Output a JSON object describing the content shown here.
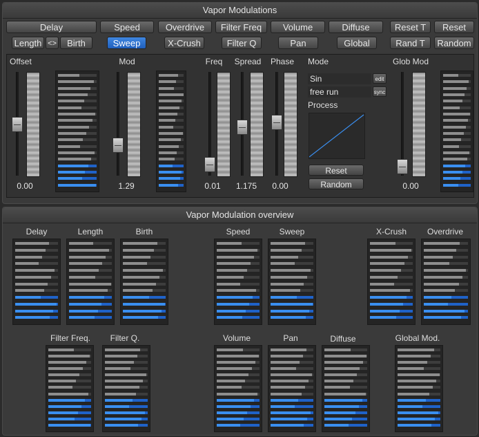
{
  "top_panel": {
    "title": "Vapor Modulations",
    "row1": [
      "Delay",
      "Speed",
      "Overdrive",
      "Filter Freq",
      "Volume",
      "Diffuse",
      "Reset T",
      "Reset"
    ],
    "row2": [
      "Length",
      "<>",
      "Birth",
      "Sweep",
      "X-Crush",
      "Filter Q",
      "Pan",
      "Global",
      "Rand T",
      "Random"
    ],
    "active_tab": "Sweep",
    "labels": {
      "offset": "Offset",
      "mod": "Mod",
      "freq": "Freq",
      "spread": "Spread",
      "phase": "Phase",
      "mode": "Mode",
      "glob_mod": "Glob Mod"
    },
    "values": {
      "offset": "0.00",
      "mod": "1.29",
      "freq": "0.01",
      "spread": "1.175",
      "phase": "0.00",
      "glob_mod": "0.00"
    },
    "mode": {
      "wave": "Sin",
      "wave_button": "edit",
      "run": "free run",
      "run_button": "sync",
      "process": "Process",
      "reset": "Reset",
      "random": "Random"
    }
  },
  "overview_panel": {
    "title": "Vapor Modulation overview",
    "meters": [
      {
        "label": "Delay"
      },
      {
        "label": "Length"
      },
      {
        "label": "Birth"
      },
      {
        "label": "Speed"
      },
      {
        "label": "Sweep"
      },
      {
        "label": "X-Crush"
      },
      {
        "label": "Overdrive"
      },
      {
        "label": "Filter Freq."
      },
      {
        "label": "Filter Q."
      },
      {
        "label": "Volume"
      },
      {
        "label": "Pan"
      },
      {
        "label": "Diffuse"
      },
      {
        "label": "Global Mod."
      }
    ]
  },
  "colors": {
    "accent": "#2f7be0",
    "panel": "#3a3a3a",
    "background": "#2b2b2b"
  }
}
